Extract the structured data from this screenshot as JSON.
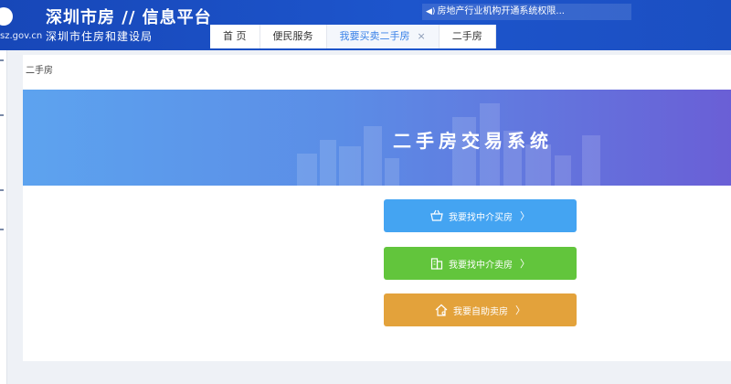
{
  "header": {
    "domain": "sz.gov.cn",
    "site_title": "深圳市房 ∕∕ 信息平台",
    "site_subtitle": "深圳市住房和建设局",
    "notice": "房地产行业机构开通系统权限...",
    "brand_color": "#1d55cc"
  },
  "tabs": [
    {
      "label": "首 页"
    },
    {
      "label": "便民服务"
    },
    {
      "label": "我要买卖二手房",
      "active": true,
      "close": "×"
    },
    {
      "label": "二手房"
    }
  ],
  "content": {
    "breadcrumb": "二手房",
    "banner_title": "二手房交易系统",
    "actions": [
      {
        "label": "我要找中介买房",
        "chevron": "〉",
        "icon": "basket-icon",
        "color": "#44a4f2"
      },
      {
        "label": "我要找中介卖房",
        "chevron": "〉",
        "icon": "building-icon",
        "color": "#62c53c"
      },
      {
        "label": "我要自助卖房",
        "chevron": "〉",
        "icon": "house-icon",
        "color": "#e3a23b"
      }
    ]
  }
}
